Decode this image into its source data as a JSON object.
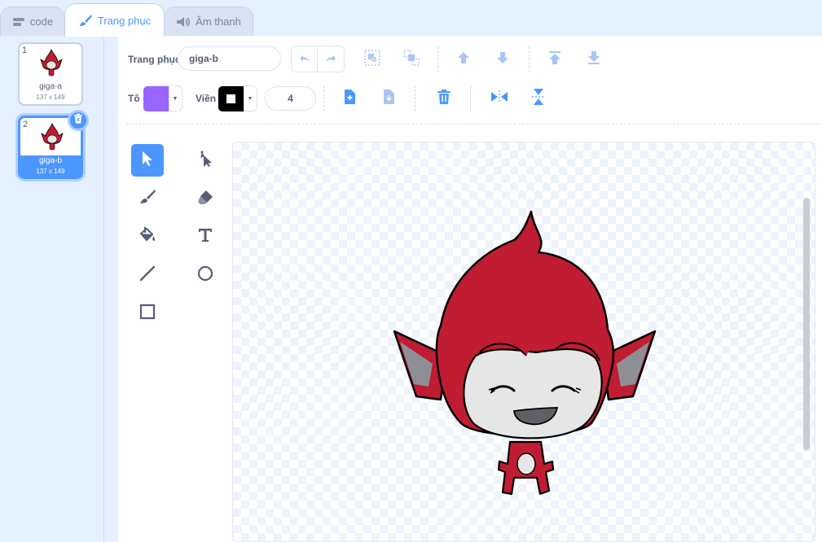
{
  "tabs": [
    {
      "label": "code",
      "icon": "code-icon"
    },
    {
      "label": "Trang phục",
      "icon": "brush-icon"
    },
    {
      "label": "Âm thanh",
      "icon": "speaker-icon"
    }
  ],
  "costumes": [
    {
      "number": "1",
      "name": "giga-a",
      "size": "137 x 149"
    },
    {
      "number": "2",
      "name": "giga-b",
      "size": "137 x 149"
    }
  ],
  "toolbar": {
    "costume_label": "Trang phục",
    "costume_name": "giga-b",
    "fill_label": "Tô",
    "outline_label": "Viền",
    "stroke_width": "4"
  },
  "colors": {
    "accent": "#4c97ff",
    "fill_swatch": "#9966ff",
    "outline_swatch": "#000000",
    "sprite_red": "#c01c32"
  }
}
